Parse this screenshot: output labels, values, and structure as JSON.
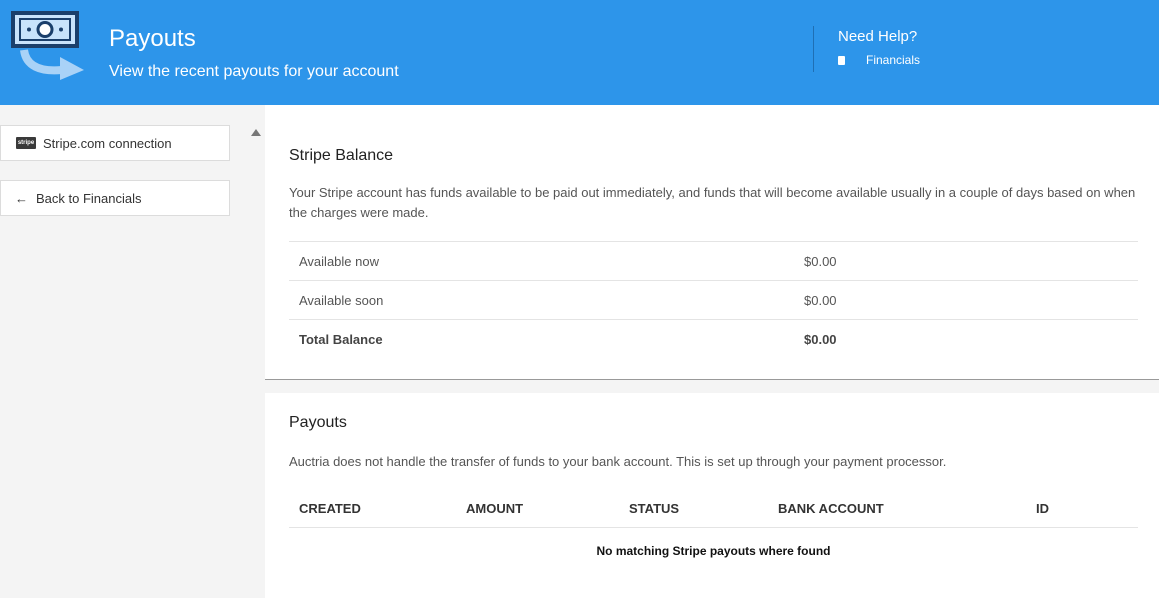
{
  "header": {
    "title": "Payouts",
    "subtitle": "View the recent payouts for your account",
    "help_title": "Need Help?",
    "help_link": "Financials",
    "logo_icon": "payout-money-icon",
    "book_icon": "book-icon",
    "background": "#2d95ea"
  },
  "sidebar": {
    "stripe_badge": "stripe",
    "stripe_label": "Stripe.com connection",
    "back_label": "Back to Financials",
    "back_icon": "arrow-left-icon"
  },
  "balance": {
    "title": "Stripe Balance",
    "description": "Your Stripe account has funds available to be paid out immediately, and funds that will become available usually in a couple of days based on when the charges were made.",
    "rows": [
      {
        "label": "Available now",
        "value": "$0.00"
      },
      {
        "label": "Available soon",
        "value": "$0.00"
      },
      {
        "label": "Total Balance",
        "value": "$0.00"
      }
    ]
  },
  "payouts": {
    "title": "Payouts",
    "description": "Auctria does not handle the transfer of funds to your bank account. This is set up through your payment processor.",
    "columns": [
      "CREATED",
      "AMOUNT",
      "STATUS",
      "BANK ACCOUNT",
      "ID"
    ],
    "empty_message": "No matching Stripe payouts where found"
  }
}
